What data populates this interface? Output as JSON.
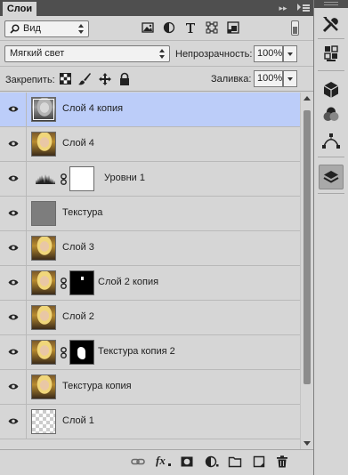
{
  "panel": {
    "tab_title": "Слои",
    "collapse_glyph": "▸▸"
  },
  "filter": {
    "kind_label": "Вид",
    "icons": [
      "image-filter-icon",
      "adjustment-filter-icon",
      "text-filter-icon",
      "shape-filter-icon",
      "smart-object-filter-icon"
    ]
  },
  "blend": {
    "mode_value": "Мягкий свет",
    "opacity_label": "Непрозрачность:",
    "opacity_value": "100%"
  },
  "lock": {
    "label": "Закрепить:",
    "icons": [
      "lock-transparent-icon",
      "lock-paint-icon",
      "lock-move-icon",
      "lock-all-icon"
    ],
    "fill_label": "Заливка:",
    "fill_value": "100%"
  },
  "layers": [
    {
      "name": "Слой 4 копия",
      "thumb": "photo-gray",
      "mask": null,
      "selected": true
    },
    {
      "name": "Слой 4",
      "thumb": "photo",
      "mask": null,
      "selected": false
    },
    {
      "name": "Уровни 1",
      "thumb": "levels",
      "mask": "white",
      "selected": false
    },
    {
      "name": "Текстура",
      "thumb": "gray",
      "mask": null,
      "selected": false
    },
    {
      "name": "Слой 3",
      "thumb": "photo",
      "mask": null,
      "selected": false
    },
    {
      "name": "Слой 2 копия",
      "thumb": "photo",
      "mask": "black",
      "selected": false
    },
    {
      "name": "Слой 2",
      "thumb": "photo",
      "mask": null,
      "selected": false
    },
    {
      "name": "Текстура копия 2",
      "thumb": "photo",
      "mask": "black",
      "selected": false
    },
    {
      "name": "Текстура копия",
      "thumb": "photo",
      "mask": null,
      "selected": false
    },
    {
      "name": "Слой 1",
      "thumb": "checker",
      "mask": null,
      "selected": false
    }
  ],
  "bottom_toolbar": {
    "fx_label": "fx",
    "icons": [
      "link-layers-icon",
      "layer-style-icon",
      "add-mask-icon",
      "adjustment-layer-icon",
      "new-group-icon",
      "new-layer-icon",
      "delete-layer-icon"
    ]
  },
  "dock": {
    "icons": [
      "tools-icon",
      "properties-icon",
      "3d-icon",
      "channels-icon",
      "paths-icon",
      "layers-icon"
    ],
    "active": "layers-icon"
  },
  "colors": {
    "selected_row": "#bccdf9",
    "panel_bg": "#d6d6d6",
    "titlebar": "#4f4f4f"
  }
}
